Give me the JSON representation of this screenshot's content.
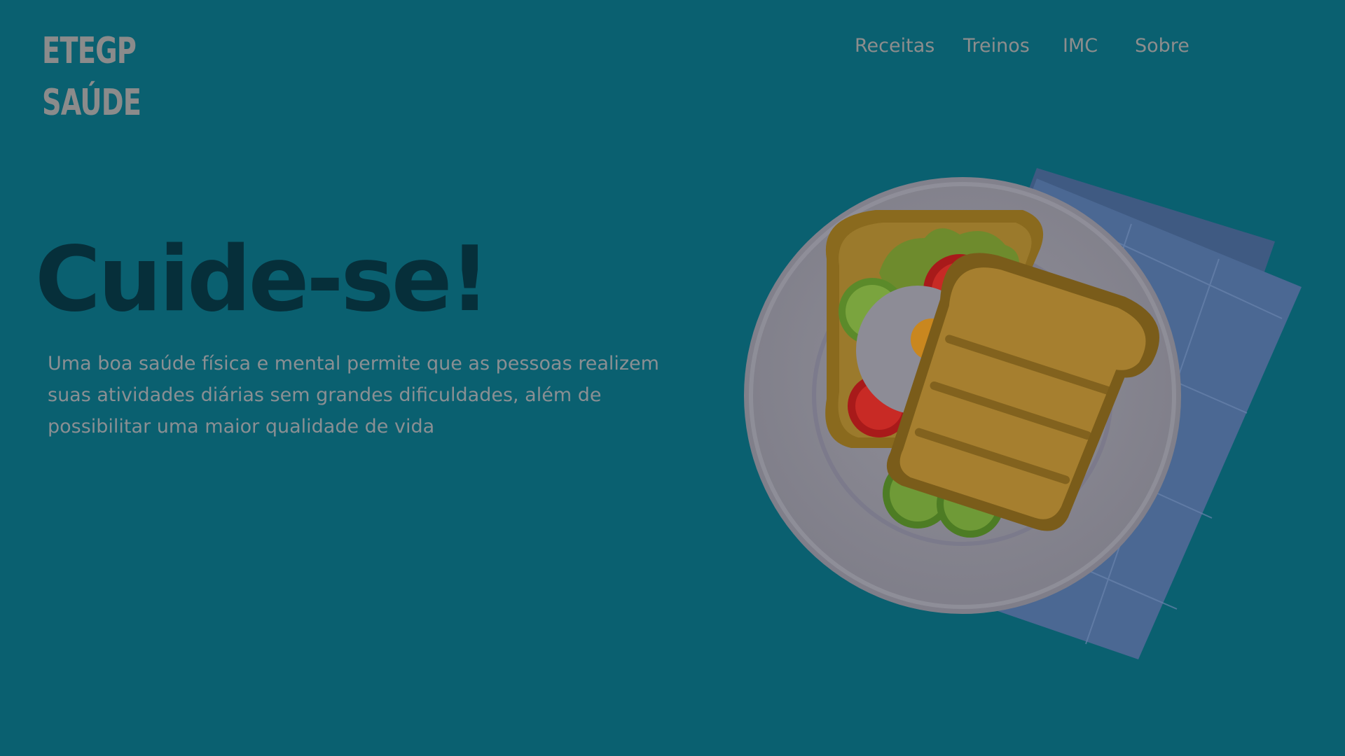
{
  "brand": {
    "line1": "ETEGP",
    "line2": "SAÚDE"
  },
  "nav": {
    "items": [
      "Receitas",
      "Treinos",
      "IMC",
      "Sobre"
    ]
  },
  "hero": {
    "title": "Cuide-se!",
    "description": "Uma boa saúde física e mental permite que as pessoas realizem suas atividades diárias sem grandes dificuldades, além de possibilitar uma maior qualidade de vida"
  },
  "colors": {
    "background": "#0a6070",
    "title": "#062f3a",
    "muted_text": "#8b8b8b",
    "napkin": "#4a6690",
    "plate": "#8a8a92",
    "toast": "#9a7a2a"
  },
  "illustration": {
    "icon": "toast-plate-illustration"
  }
}
